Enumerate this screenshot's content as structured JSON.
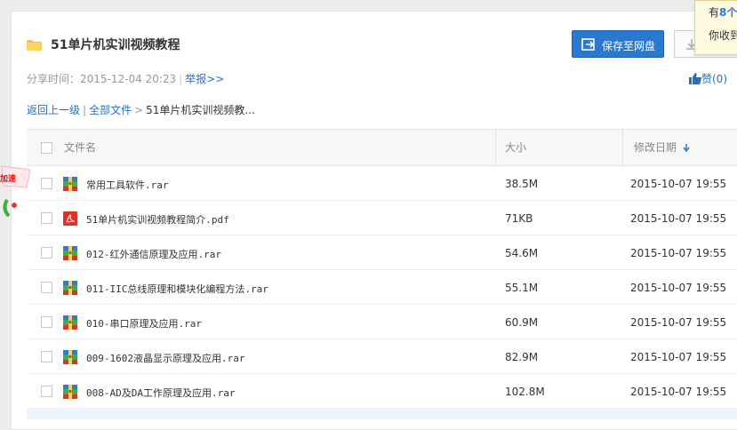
{
  "header": {
    "title": "51单片机实训视频教程",
    "save_label": "保存至网盘"
  },
  "tooltip": {
    "line1_prefix": "有",
    "line1_count": "8个",
    "line2": "你收到"
  },
  "meta": {
    "share_time_label": "分享时间：",
    "share_time": "2015-12-04 20:23",
    "report_link": "举报>>",
    "like_label": "赞(0)"
  },
  "breadcrumb": {
    "back": "返回上一级",
    "all_files": "全部文件",
    "current": "51单片机实训视频教..."
  },
  "side_badge": {
    "label": "加速"
  },
  "table": {
    "headers": {
      "name": "文件名",
      "size": "大小",
      "date": "修改日期"
    },
    "rows": [
      {
        "name": "常用工具软件.rar",
        "size": "38.5M",
        "date": "2015-10-07 19:55",
        "icon": "rar-icon"
      },
      {
        "name": "51单片机实训视频教程简介.pdf",
        "size": "71KB",
        "date": "2015-10-07 19:55",
        "icon": "pdf-icon"
      },
      {
        "name": "012-红外通信原理及应用.rar",
        "size": "54.6M",
        "date": "2015-10-07 19:55",
        "icon": "rar-icon"
      },
      {
        "name": "011-IIC总线原理和模块化编程方法.rar",
        "size": "55.1M",
        "date": "2015-10-07 19:55",
        "icon": "rar-icon"
      },
      {
        "name": "010-串口原理及应用.rar",
        "size": "60.9M",
        "date": "2015-10-07 19:55",
        "icon": "rar-icon"
      },
      {
        "name": "009-1602液晶显示原理及应用.rar",
        "size": "82.9M",
        "date": "2015-10-07 19:55",
        "icon": "rar-icon"
      },
      {
        "name": "008-AD及DA工作原理及应用.rar",
        "size": "102.8M",
        "date": "2015-10-07 19:55",
        "icon": "rar-icon"
      }
    ]
  },
  "colors": {
    "accent": "#2a79d1",
    "link": "#2a6fc1",
    "rar_green": "#4aa84a",
    "rar_blue": "#3a77c9",
    "rar_red": "#d03a2a",
    "pdf_red": "#d9342b"
  }
}
